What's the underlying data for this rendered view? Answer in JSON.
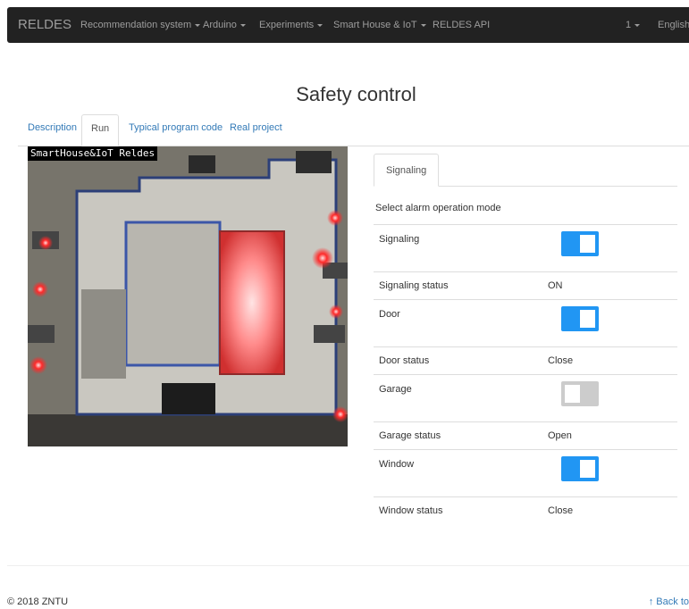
{
  "navbar": {
    "brand": "RELDES",
    "items": [
      {
        "label": "Recommendation system",
        "dropdown": true
      },
      {
        "label": "Arduino",
        "dropdown": true
      },
      {
        "label": "Experiments",
        "dropdown": true
      },
      {
        "label": "Smart House & IoT",
        "dropdown": true
      },
      {
        "label": "RELDES API",
        "dropdown": false
      }
    ],
    "user": "1",
    "language": "English"
  },
  "page": {
    "title": "Safety control"
  },
  "tabs": [
    {
      "label": "Description",
      "active": false
    },
    {
      "label": "Run",
      "active": true
    },
    {
      "label": "Typical program code",
      "active": false
    },
    {
      "label": "Real project",
      "active": false
    }
  ],
  "camera": {
    "caption": "SmartHouse&IoT Reldes"
  },
  "panel": {
    "tab": "Signaling",
    "mode_label": "Select alarm operation mode",
    "rows": [
      {
        "label": "Signaling",
        "toggle": true
      },
      {
        "label": "Signaling status",
        "value": "ON"
      },
      {
        "label": "Door",
        "toggle": true
      },
      {
        "label": "Door status",
        "value": "Close"
      },
      {
        "label": "Garage",
        "toggle": false
      },
      {
        "label": "Garage status",
        "value": "Open"
      },
      {
        "label": "Window",
        "toggle": true
      },
      {
        "label": "Window status",
        "value": "Close"
      }
    ]
  },
  "footer": {
    "copyright": "© 2018 ZNTU",
    "back_to_top": "↑ Back to"
  },
  "colors": {
    "navbar_bg": "#222222",
    "link": "#337ab7",
    "toggle_on": "#2196f3",
    "toggle_off": "#cccccc"
  },
  "icons": {
    "caret": "caret-down-icon"
  }
}
